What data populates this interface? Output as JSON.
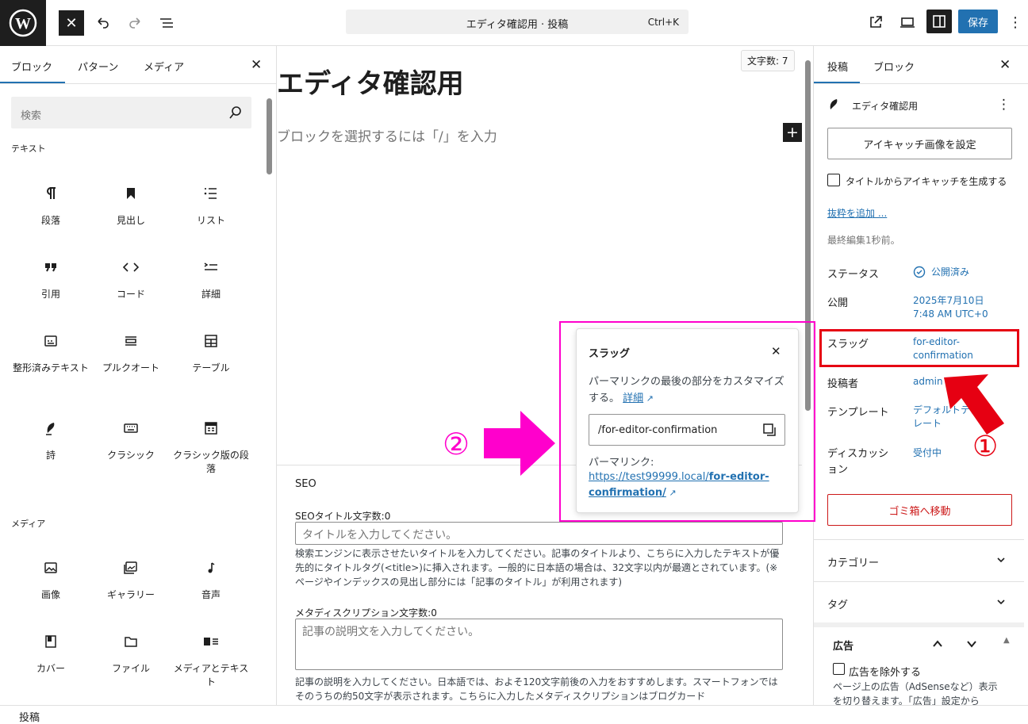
{
  "topbar": {
    "command_title": "エディタ確認用 · 投稿",
    "command_shortcut": "Ctrl+K",
    "save_label": "保存"
  },
  "inserter": {
    "tabs": [
      "ブロック",
      "パターン",
      "メディア"
    ],
    "search_placeholder": "検索",
    "text_category": "テキスト",
    "text_blocks": [
      {
        "label": "段落",
        "icon": "paragraph-icon"
      },
      {
        "label": "見出し",
        "icon": "heading-icon"
      },
      {
        "label": "リスト",
        "icon": "list-icon"
      },
      {
        "label": "引用",
        "icon": "quote-icon"
      },
      {
        "label": "コード",
        "icon": "code-icon"
      },
      {
        "label": "詳細",
        "icon": "details-icon"
      },
      {
        "label": "整形済みテキスト",
        "icon": "preformatted-icon"
      },
      {
        "label": "プルクオート",
        "icon": "pullquote-icon"
      },
      {
        "label": "テーブル",
        "icon": "table-icon"
      },
      {
        "label": "詩",
        "icon": "verse-icon"
      },
      {
        "label": "クラシック",
        "icon": "classic-icon"
      },
      {
        "label": "クラシック版の段落",
        "icon": "classic-paragraph-icon"
      }
    ],
    "media_category": "メディア",
    "media_blocks": [
      {
        "label": "画像",
        "icon": "image-icon"
      },
      {
        "label": "ギャラリー",
        "icon": "gallery-icon"
      },
      {
        "label": "音声",
        "icon": "audio-icon"
      },
      {
        "label": "カバー",
        "icon": "cover-icon"
      },
      {
        "label": "ファイル",
        "icon": "file-icon"
      },
      {
        "label": "メディアとテキスト",
        "icon": "media-text-icon"
      }
    ]
  },
  "editor": {
    "word_count": "文字数: 7",
    "title": "エディタ確認用",
    "placeholder": "ブロックを選択するには「/」を入力"
  },
  "seo": {
    "heading": "SEO",
    "title_label": "SEOタイトル文字数:0",
    "title_placeholder": "タイトルを入力してください。",
    "title_help": "検索エンジンに表示させたいタイトルを入力してください。記事のタイトルより、こちらに入力したテキストが優先的にタイトルタグ(<title>)に挿入されます。一般的に日本語の場合は、32文字以内が最適とされています。(※ページやインデックスの見出し部分には「記事のタイトル」が利用されます)",
    "desc_label": "メタディスクリプション文字数:0",
    "desc_placeholder": "記事の説明文を入力してください。",
    "desc_help": "記事の説明を入力してください。日本語では、およそ120文字前後の入力をおすすめします。スマートフォンではそのうちの約50文字が表示されます。こちらに入力したメタディスクリプションはブログカード"
  },
  "slug_popover": {
    "title": "スラッグ",
    "description": "パーマリンクの最後の部分をカスタマイズする。",
    "details_link": "詳細",
    "slug_value": "/for-editor-confirmation",
    "permalink_label": "パーマリンク:",
    "permalink_url_1": "https://test99999.local/",
    "permalink_url_bold": "for-editor-",
    "permalink_url_2": "confirmation/"
  },
  "sidebar": {
    "tabs": [
      "投稿",
      "ブロック"
    ],
    "post_title": "エディタ確認用",
    "featured_image_button": "アイキャッチ画像を設定",
    "generate_checkbox": "タイトルからアイキャッチを生成する",
    "excerpt_link": "抜粋を追加 ...",
    "last_edited": "最終編集1秒前。",
    "status_label": "ステータス",
    "status_value": "公開済み",
    "publish_label": "公開",
    "publish_value_1": "2025年7月10日",
    "publish_value_2": "7:48 AM UTC+0",
    "slug_label": "スラッグ",
    "slug_value_1": "for-editor-",
    "slug_value_2": "confirmation",
    "author_label": "投稿者",
    "author_value": "admin",
    "template_label": "テンプレート",
    "template_value_1": "デフォルトテン",
    "template_value_2": "レート",
    "discussion_label_1": "ディスカッシ",
    "discussion_label_2": "ョン",
    "discussion_value": "受付中",
    "trash_button": "ゴミ箱へ移動",
    "category_section": "カテゴリー",
    "tag_section": "タグ",
    "ad_section": "広告",
    "ad_checkbox": "広告を除外する",
    "ad_help": "ページ上の広告（AdSenseなど）表示を切り替えます。「広告」設定から"
  },
  "annotations": {
    "marker_1": "①",
    "marker_2": "②",
    "magenta": "#ff00cc",
    "red": "#e60012"
  },
  "statusbar": {
    "label": "投稿"
  }
}
